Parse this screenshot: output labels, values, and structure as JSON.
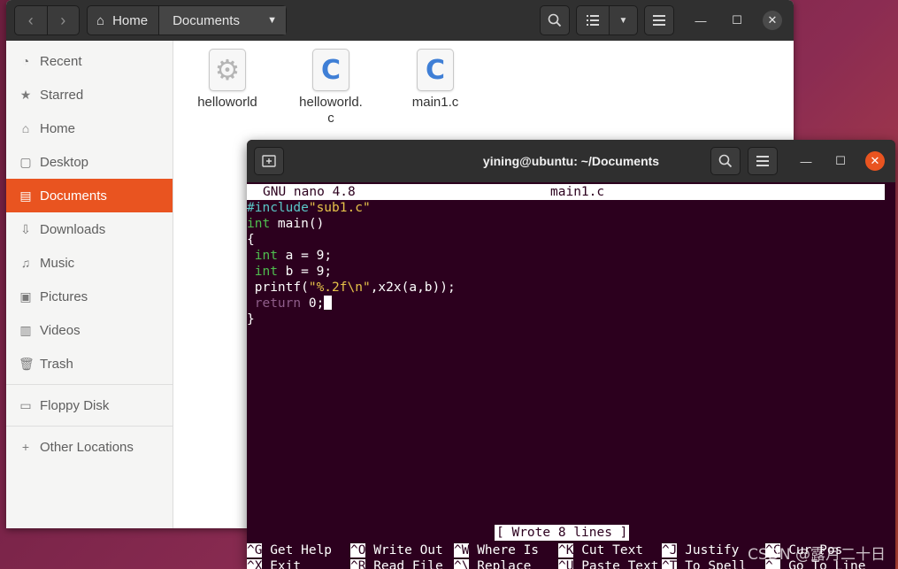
{
  "files_window": {
    "path": {
      "home": "Home",
      "current": "Documents"
    },
    "sidebar": [
      {
        "label": "Recent",
        "icon": "clock-icon",
        "glyph": "◔"
      },
      {
        "label": "Starred",
        "icon": "star-icon",
        "glyph": "★"
      },
      {
        "label": "Home",
        "icon": "home-icon",
        "glyph": "⌂"
      },
      {
        "label": "Desktop",
        "icon": "desktop-icon",
        "glyph": "▢"
      },
      {
        "label": "Documents",
        "icon": "document-icon",
        "glyph": "▤"
      },
      {
        "label": "Downloads",
        "icon": "download-icon",
        "glyph": "⇩"
      },
      {
        "label": "Music",
        "icon": "music-icon",
        "glyph": "♫"
      },
      {
        "label": "Pictures",
        "icon": "picture-icon",
        "glyph": "▣"
      },
      {
        "label": "Videos",
        "icon": "video-icon",
        "glyph": "▥"
      },
      {
        "label": "Trash",
        "icon": "trash-icon",
        "glyph": "🗑"
      },
      {
        "label": "Floppy Disk",
        "icon": "floppy-icon",
        "glyph": "▭"
      },
      {
        "label": "Other Locations",
        "icon": "plus-icon",
        "glyph": "+"
      }
    ],
    "active_item": "Documents",
    "files": [
      {
        "name": "helloworld",
        "kind": "executable",
        "icon": "gear-icon"
      },
      {
        "name": "helloworld.c",
        "line1": "helloworld.",
        "line2": "c",
        "kind": "c-source",
        "icon": "c-file-icon"
      },
      {
        "name": "main1.c",
        "kind": "c-source",
        "icon": "c-file-icon"
      }
    ]
  },
  "terminal": {
    "title": "yining@ubuntu: ~/Documents",
    "nano_version": "GNU nano 4.8",
    "filename": "main1.c",
    "code": {
      "l1_directive": "#include",
      "l1_string": "\"sub1.c\"",
      "l2_type": "int",
      "l2_rest": " main()",
      "l3": "{",
      "l4_type": "int",
      "l4_rest": " a = 9;",
      "l5_type": "int",
      "l5_rest": " b = 9;",
      "l6_start": " printf(",
      "l6_string": "\"%.2f\\n\"",
      "l6_rest": ",x2x(a,b));",
      "l7_keyword": "return",
      "l7_rest": " 0;",
      "l8": "}"
    },
    "status": "[ Wrote 8 lines ]",
    "shortcuts_row1": [
      {
        "key": "^G",
        "label": " Get Help"
      },
      {
        "key": "^O",
        "label": " Write Out"
      },
      {
        "key": "^W",
        "label": " Where Is"
      },
      {
        "key": "^K",
        "label": " Cut Text"
      },
      {
        "key": "^J",
        "label": " Justify"
      },
      {
        "key": "^C",
        "label": " Cur Pos"
      }
    ],
    "shortcuts_row2": [
      {
        "key": "^X",
        "label": " Exit"
      },
      {
        "key": "^R",
        "label": " Read File"
      },
      {
        "key": "^\\",
        "label": " Replace"
      },
      {
        "key": "^U",
        "label": " Paste Text"
      },
      {
        "key": "^T",
        "label": " To Spell"
      },
      {
        "key": "^_",
        "label": " Go To Line"
      }
    ]
  },
  "watermark": "CSDN @露月二十日"
}
